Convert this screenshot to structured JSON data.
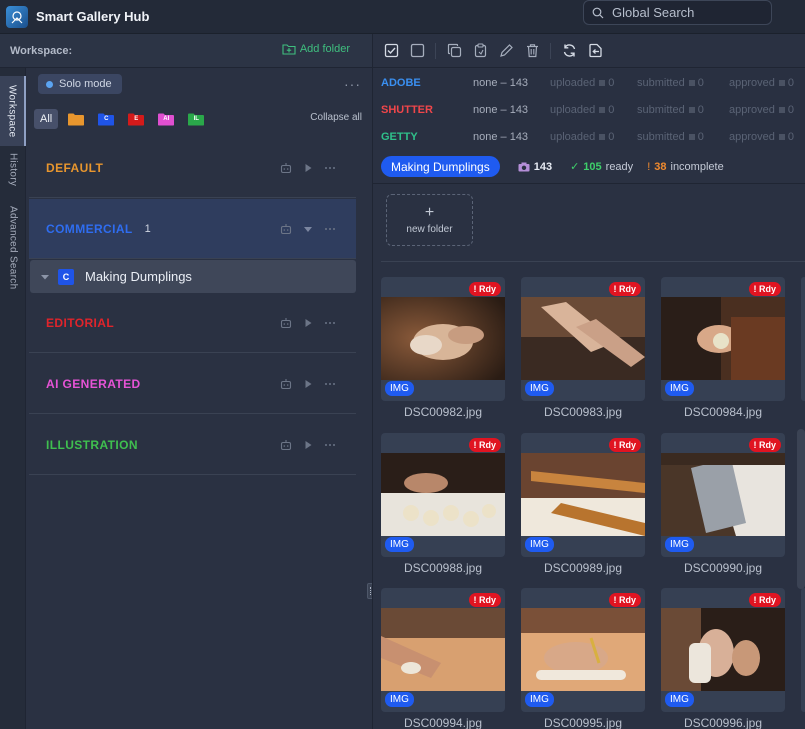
{
  "app": {
    "title": "Smart Gallery Hub"
  },
  "search": {
    "placeholder": "Global Search"
  },
  "left": {
    "workspace_label": "Workspace:",
    "add_folder": "Add folder",
    "vtabs": [
      "Workspace",
      "History",
      "Advanced Search"
    ],
    "solo_mode": "Solo mode",
    "filter_all": "All",
    "filter_icons": [
      {
        "name": "folder-orange-icon",
        "color": "#e8962e",
        "letter": ""
      },
      {
        "name": "folder-commercial-icon",
        "color": "#1f54e8",
        "letter": "C"
      },
      {
        "name": "folder-editorial-icon",
        "color": "#d41a1a",
        "letter": "E"
      },
      {
        "name": "folder-ai-icon",
        "color": "#e04fd0",
        "letter": "AI"
      },
      {
        "name": "folder-illustration-icon",
        "color": "#2aa84a",
        "letter": "IL"
      }
    ],
    "collapse_all": "Collapse all",
    "categories": [
      {
        "name": "DEFAULT",
        "color": "#e8962e",
        "count": ""
      },
      {
        "name": "COMMERCIAL",
        "color": "#2f6df0",
        "count": "1"
      },
      {
        "name": "EDITORIAL",
        "color": "#e0242b",
        "count": ""
      },
      {
        "name": "AI GENERATED",
        "color": "#e653d6",
        "count": ""
      },
      {
        "name": "ILLUSTRATION",
        "color": "#3fbf4f",
        "count": ""
      }
    ],
    "subfolder": {
      "badge": "C",
      "name": "Making Dumplings"
    }
  },
  "agencies": [
    {
      "name": "ADOBE",
      "color": "#3a8ff0",
      "range": "none – 143",
      "uploaded": "uploaded",
      "uploaded_n": "0",
      "submitted": "submitted",
      "submitted_n": "0",
      "approved": "approved",
      "approved_n": "0"
    },
    {
      "name": "SHUTTER",
      "color": "#f0464a",
      "range": "none – 143",
      "uploaded": "uploaded",
      "uploaded_n": "0",
      "submitted": "submitted",
      "submitted_n": "0",
      "approved": "approved",
      "approved_n": "0"
    },
    {
      "name": "GETTY",
      "color": "#2fc08a",
      "range": "none – 143",
      "uploaded": "uploaded",
      "uploaded_n": "0",
      "submitted": "submitted",
      "submitted_n": "0",
      "approved": "approved",
      "approved_n": "0"
    }
  ],
  "summary": {
    "folder": "Making Dumplings",
    "total": "143",
    "ready_check": "✓",
    "ready_count": "105",
    "ready_label": "ready",
    "incomplete_mark": "!",
    "incomplete_count": "38",
    "incomplete_label": "incomplete"
  },
  "new_folder": {
    "plus": "+",
    "label": "new folder"
  },
  "cards": [
    {
      "file": "DSC00982.jpg",
      "status": "! Rdy",
      "type": "IMG"
    },
    {
      "file": "DSC00983.jpg",
      "status": "! Rdy",
      "type": "IMG"
    },
    {
      "file": "DSC00984.jpg",
      "status": "! Rdy",
      "type": "IMG"
    },
    {
      "file": "DSC00988.jpg",
      "status": "! Rdy",
      "type": "IMG"
    },
    {
      "file": "DSC00989.jpg",
      "status": "! Rdy",
      "type": "IMG"
    },
    {
      "file": "DSC00990.jpg",
      "status": "! Rdy",
      "type": "IMG"
    },
    {
      "file": "DSC00994.jpg",
      "status": "! Rdy",
      "type": "IMG"
    },
    {
      "file": "DSC00995.jpg",
      "status": "! Rdy",
      "type": "IMG"
    },
    {
      "file": "DSC00996.jpg",
      "status": "! Rdy",
      "type": "IMG"
    }
  ],
  "colors": {
    "accent_blue": "#1f5bf0",
    "ready_green": "#3ecf6a",
    "incomplete_orange": "#f08a2e",
    "status_red": "#e01421"
  }
}
